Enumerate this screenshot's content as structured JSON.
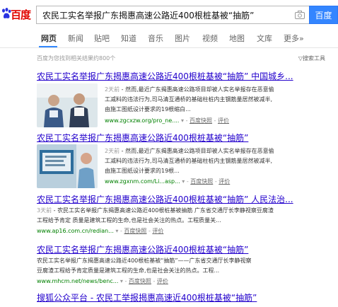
{
  "header": {
    "logo_text": "百度",
    "query": "农民工实名举报广东揭惠高速公路近400根桩基被“抽筋”",
    "search_button": "百度"
  },
  "tabs": [
    "网页",
    "新闻",
    "贴吧",
    "知道",
    "音乐",
    "图片",
    "视频",
    "地图",
    "文库",
    "更多»"
  ],
  "result_count": "百度为您找到相关结果约800个",
  "search_tools": "搜索工具",
  "results": [
    {
      "title": "农民工实名举报广东揭惠高速公路近400根桩基被“抽筋” 中国城乡...",
      "date": "2天前",
      "abstract_1": " - 然而,最近广东揭惠高速公路项目却被人实名举报存在恶意偷",
      "abstract_2": "工减料的违法行为,司马清互通桥的基础柱桩内主钢筋量居然被减半,",
      "abstract_3": "由施工图纸设计要求的19根缩白...",
      "url": "www.zgcxzw.org/pro_ne....",
      "snapshot": "百度快照",
      "eval": "评价"
    },
    {
      "title": "农民工实名举报广东揭惠高速公路近400根桩基被“抽筋”",
      "date": "2天前",
      "abstract_1": " - 然而,最近广东揭惠高速公路项目却被人实名举报存在恶意偷",
      "abstract_2": "工减料的违法行为,司马清互通桥的基础柱桩内主钢筋量居然被减半,",
      "abstract_3": "由施工图纸设计要求的19根...",
      "url": "www.zgxnm.com/Li...asp...",
      "snapshot": "百度快照",
      "eval": "评价"
    },
    {
      "title": "农民工实名举报广东揭惠高速公路近400根桩基被“抽筋” 人民法治...",
      "date": "3天前",
      "abstract_1": " - 农民工实名举报广东揭惠高速公路近400根桩基被抽筋 广东省交通厅长李静视察豆腐渣",
      "abstract_2": "工程给予肯定 质量是建筑工程的生命,也是社会关注的热点。工程质量关...",
      "url": "www.ap16.com.cn/redian...",
      "snapshot": "百度快照",
      "eval": "评价"
    },
    {
      "title": "农民工实名举报广东揭惠高速公路近400根桩基被“抽筋”",
      "abstract_1": "农民工实名举报广东揭惠高速公路近400根桩基被“抽筋”——广东省交通厅长李静视察",
      "abstract_2": "豆腐渣工程给予肯定质量是建筑工程的生命,也是社会关注的热点。工程...",
      "url": "www.mhcm.net/news/benc...",
      "snapshot": "百度快照",
      "eval": "评价"
    },
    {
      "title": "搜狐公众平台 - 农民工举报揭惠高速近400根桩基被“抽筋”"
    }
  ]
}
